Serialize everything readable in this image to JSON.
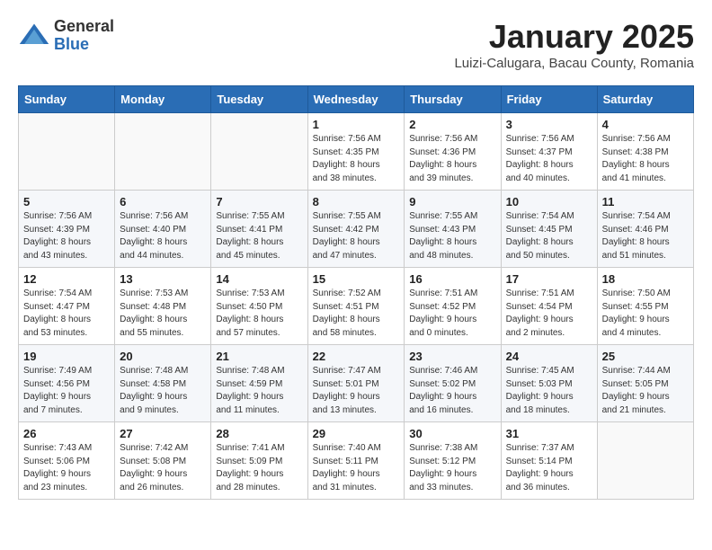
{
  "header": {
    "logo_general": "General",
    "logo_blue": "Blue",
    "month_title": "January 2025",
    "location": "Luizi-Calugara, Bacau County, Romania"
  },
  "weekdays": [
    "Sunday",
    "Monday",
    "Tuesday",
    "Wednesday",
    "Thursday",
    "Friday",
    "Saturday"
  ],
  "weeks": [
    [
      {
        "day": "",
        "info": ""
      },
      {
        "day": "",
        "info": ""
      },
      {
        "day": "",
        "info": ""
      },
      {
        "day": "1",
        "info": "Sunrise: 7:56 AM\nSunset: 4:35 PM\nDaylight: 8 hours\nand 38 minutes."
      },
      {
        "day": "2",
        "info": "Sunrise: 7:56 AM\nSunset: 4:36 PM\nDaylight: 8 hours\nand 39 minutes."
      },
      {
        "day": "3",
        "info": "Sunrise: 7:56 AM\nSunset: 4:37 PM\nDaylight: 8 hours\nand 40 minutes."
      },
      {
        "day": "4",
        "info": "Sunrise: 7:56 AM\nSunset: 4:38 PM\nDaylight: 8 hours\nand 41 minutes."
      }
    ],
    [
      {
        "day": "5",
        "info": "Sunrise: 7:56 AM\nSunset: 4:39 PM\nDaylight: 8 hours\nand 43 minutes."
      },
      {
        "day": "6",
        "info": "Sunrise: 7:56 AM\nSunset: 4:40 PM\nDaylight: 8 hours\nand 44 minutes."
      },
      {
        "day": "7",
        "info": "Sunrise: 7:55 AM\nSunset: 4:41 PM\nDaylight: 8 hours\nand 45 minutes."
      },
      {
        "day": "8",
        "info": "Sunrise: 7:55 AM\nSunset: 4:42 PM\nDaylight: 8 hours\nand 47 minutes."
      },
      {
        "day": "9",
        "info": "Sunrise: 7:55 AM\nSunset: 4:43 PM\nDaylight: 8 hours\nand 48 minutes."
      },
      {
        "day": "10",
        "info": "Sunrise: 7:54 AM\nSunset: 4:45 PM\nDaylight: 8 hours\nand 50 minutes."
      },
      {
        "day": "11",
        "info": "Sunrise: 7:54 AM\nSunset: 4:46 PM\nDaylight: 8 hours\nand 51 minutes."
      }
    ],
    [
      {
        "day": "12",
        "info": "Sunrise: 7:54 AM\nSunset: 4:47 PM\nDaylight: 8 hours\nand 53 minutes."
      },
      {
        "day": "13",
        "info": "Sunrise: 7:53 AM\nSunset: 4:48 PM\nDaylight: 8 hours\nand 55 minutes."
      },
      {
        "day": "14",
        "info": "Sunrise: 7:53 AM\nSunset: 4:50 PM\nDaylight: 8 hours\nand 57 minutes."
      },
      {
        "day": "15",
        "info": "Sunrise: 7:52 AM\nSunset: 4:51 PM\nDaylight: 8 hours\nand 58 minutes."
      },
      {
        "day": "16",
        "info": "Sunrise: 7:51 AM\nSunset: 4:52 PM\nDaylight: 9 hours\nand 0 minutes."
      },
      {
        "day": "17",
        "info": "Sunrise: 7:51 AM\nSunset: 4:54 PM\nDaylight: 9 hours\nand 2 minutes."
      },
      {
        "day": "18",
        "info": "Sunrise: 7:50 AM\nSunset: 4:55 PM\nDaylight: 9 hours\nand 4 minutes."
      }
    ],
    [
      {
        "day": "19",
        "info": "Sunrise: 7:49 AM\nSunset: 4:56 PM\nDaylight: 9 hours\nand 7 minutes."
      },
      {
        "day": "20",
        "info": "Sunrise: 7:48 AM\nSunset: 4:58 PM\nDaylight: 9 hours\nand 9 minutes."
      },
      {
        "day": "21",
        "info": "Sunrise: 7:48 AM\nSunset: 4:59 PM\nDaylight: 9 hours\nand 11 minutes."
      },
      {
        "day": "22",
        "info": "Sunrise: 7:47 AM\nSunset: 5:01 PM\nDaylight: 9 hours\nand 13 minutes."
      },
      {
        "day": "23",
        "info": "Sunrise: 7:46 AM\nSunset: 5:02 PM\nDaylight: 9 hours\nand 16 minutes."
      },
      {
        "day": "24",
        "info": "Sunrise: 7:45 AM\nSunset: 5:03 PM\nDaylight: 9 hours\nand 18 minutes."
      },
      {
        "day": "25",
        "info": "Sunrise: 7:44 AM\nSunset: 5:05 PM\nDaylight: 9 hours\nand 21 minutes."
      }
    ],
    [
      {
        "day": "26",
        "info": "Sunrise: 7:43 AM\nSunset: 5:06 PM\nDaylight: 9 hours\nand 23 minutes."
      },
      {
        "day": "27",
        "info": "Sunrise: 7:42 AM\nSunset: 5:08 PM\nDaylight: 9 hours\nand 26 minutes."
      },
      {
        "day": "28",
        "info": "Sunrise: 7:41 AM\nSunset: 5:09 PM\nDaylight: 9 hours\nand 28 minutes."
      },
      {
        "day": "29",
        "info": "Sunrise: 7:40 AM\nSunset: 5:11 PM\nDaylight: 9 hours\nand 31 minutes."
      },
      {
        "day": "30",
        "info": "Sunrise: 7:38 AM\nSunset: 5:12 PM\nDaylight: 9 hours\nand 33 minutes."
      },
      {
        "day": "31",
        "info": "Sunrise: 7:37 AM\nSunset: 5:14 PM\nDaylight: 9 hours\nand 36 minutes."
      },
      {
        "day": "",
        "info": ""
      }
    ]
  ]
}
